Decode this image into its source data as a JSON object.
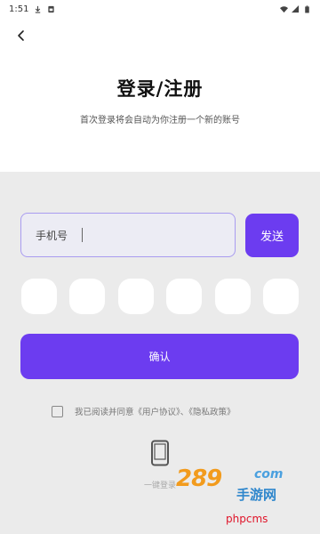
{
  "status_bar": {
    "time": "1:51",
    "left_icons": [
      "download-icon",
      "sim-card-icon"
    ],
    "right_icons": [
      "wifi-icon",
      "signal-icon",
      "battery-icon"
    ]
  },
  "header": {
    "back_icon": "chevron-left-icon",
    "title": "登录/注册",
    "subtitle": "首次登录将会自动为你注册一个新的账号"
  },
  "form": {
    "phone_placeholder": "手机号",
    "send_button_label": "发送",
    "code_box_count": 6,
    "confirm_button_label": "确认",
    "agreement_text": "我已阅读并同意《用户协议》、《隐私政策》",
    "agreement_checked": false
  },
  "alt_login": {
    "icon": "phone-icon",
    "label": "一键登录"
  },
  "watermark": {
    "number": "289",
    "domain": "com",
    "text": "手游网",
    "tag": "phpcms"
  },
  "colors": {
    "accent": "#6c3cf0",
    "panel_background": "#ebebeb",
    "input_border": "#a99cf0"
  }
}
